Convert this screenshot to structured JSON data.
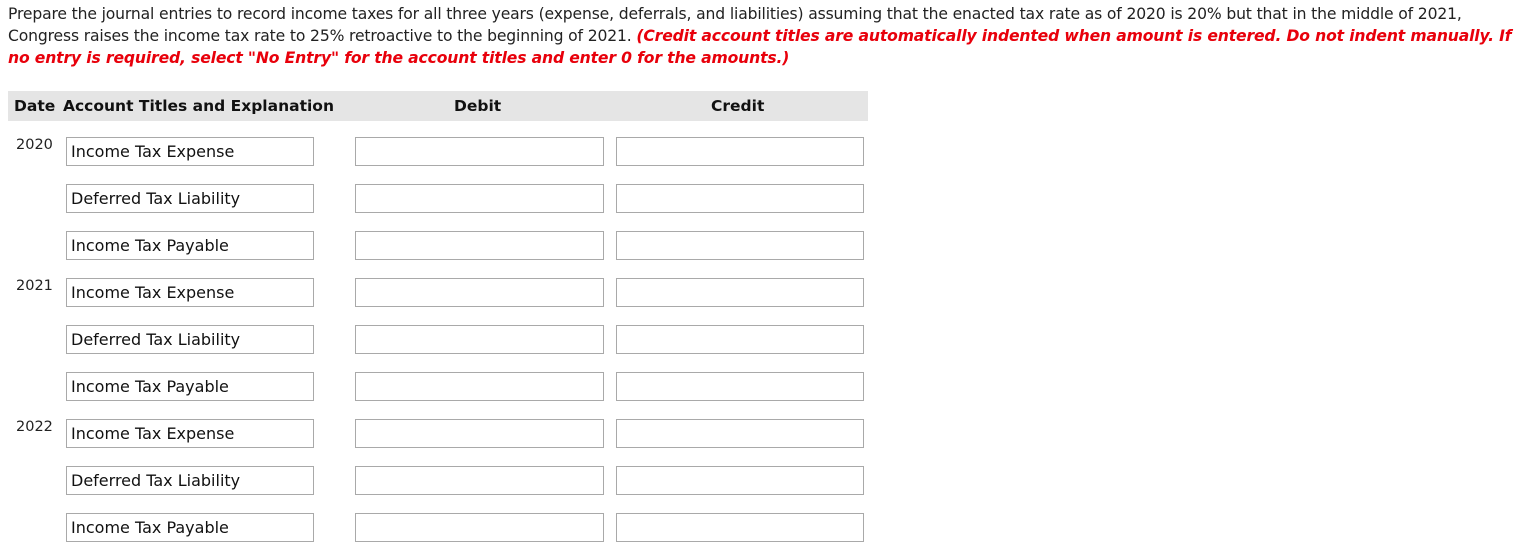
{
  "instructions": {
    "text": "Prepare the journal entries to record income taxes for all three years (expense, deferrals, and liabilities) assuming that the enacted tax rate as of 2020 is 20% but that in the middle of 2021, Congress raises the income tax rate to 25% retroactive to the beginning of 2021. ",
    "note": "(Credit account titles are automatically indented when amount is entered. Do not indent manually. If no entry is required, select \"No Entry\" for the account titles and enter 0 for the amounts.)",
    "note_color": "#e8000b"
  },
  "table": {
    "headers": {
      "date": "Date",
      "account": "Account Titles and Explanation",
      "debit": "Debit",
      "credit": "Credit"
    },
    "rows": [
      {
        "year": "2020",
        "account": "Income Tax Expense",
        "debit": "",
        "credit": ""
      },
      {
        "year": "",
        "account": "Deferred Tax Liability",
        "debit": "",
        "credit": ""
      },
      {
        "year": "",
        "account": "Income Tax Payable",
        "debit": "",
        "credit": ""
      },
      {
        "year": "2021",
        "account": "Income Tax Expense",
        "debit": "",
        "credit": ""
      },
      {
        "year": "",
        "account": "Deferred Tax Liability",
        "debit": "",
        "credit": ""
      },
      {
        "year": "",
        "account": "Income Tax Payable",
        "debit": "",
        "credit": ""
      },
      {
        "year": "2022",
        "account": "Income Tax Expense",
        "debit": "",
        "credit": ""
      },
      {
        "year": "",
        "account": "Deferred Tax Liability",
        "debit": "",
        "credit": ""
      },
      {
        "year": "",
        "account": "Income Tax Payable",
        "debit": "",
        "credit": ""
      }
    ]
  }
}
